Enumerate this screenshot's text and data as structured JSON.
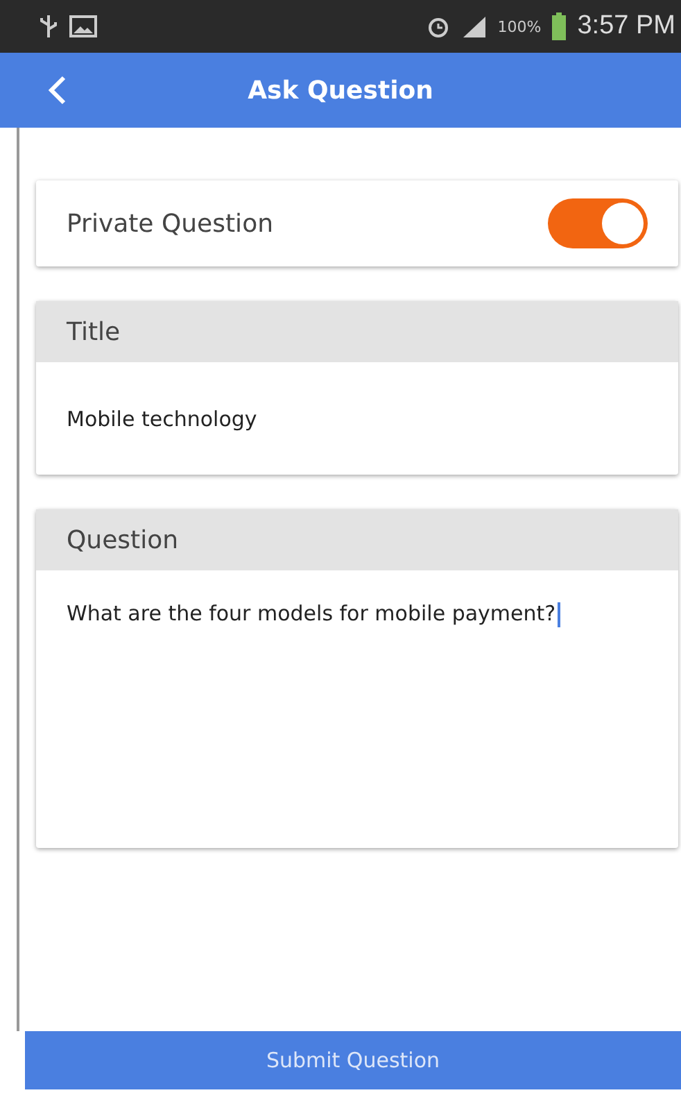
{
  "status_bar": {
    "battery": "100%",
    "time": "3:57 PM"
  },
  "app_bar": {
    "title": "Ask Question"
  },
  "private_toggle": {
    "label": "Private Question",
    "on": true
  },
  "fields": [
    {
      "label": "Title",
      "value": "Mobile technology",
      "kind": "line"
    },
    {
      "label": "Question",
      "value": "What are the four models for mobile payment?",
      "kind": "area"
    }
  ],
  "submit": {
    "label": "Submit Question"
  }
}
